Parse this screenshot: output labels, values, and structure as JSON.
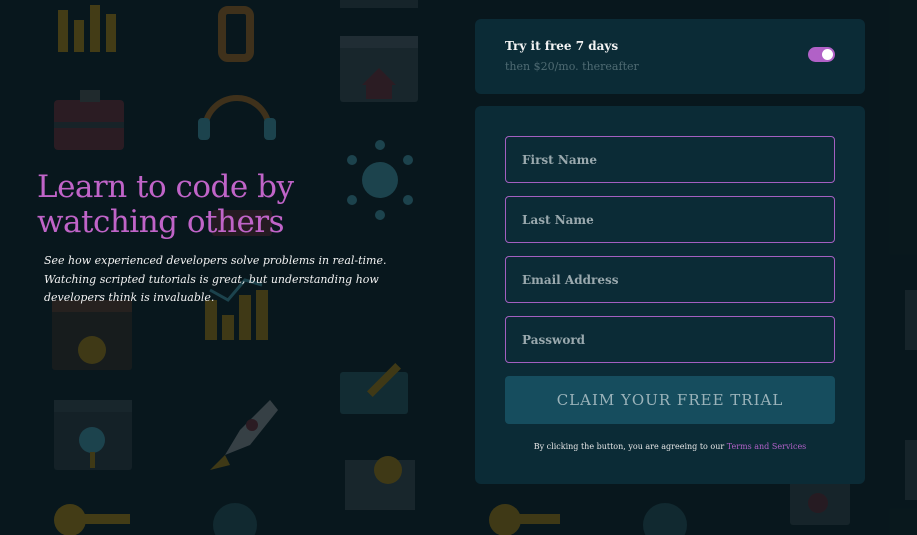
{
  "hero": {
    "title_line1": "Learn to code by",
    "title_line2": "watching others",
    "description": "See how experienced developers solve problems in real-time. Watching scripted tutorials is great, but understanding how developers think is invaluable."
  },
  "trial": {
    "title": "Try it free 7 days",
    "subtitle": "then $20/mo. thereafter",
    "toggle_on": true
  },
  "form": {
    "first_name_placeholder": "First Name",
    "last_name_placeholder": "Last Name",
    "email_placeholder": "Email Address",
    "password_placeholder": "Password",
    "submit_label": "CLAIM YOUR FREE TRIAL",
    "terms_prefix": "By clicking the button, you are agreeing to our",
    "terms_link": "Terms and Services"
  },
  "colors": {
    "accent": "#c064c8",
    "card_bg": "#0b2b36",
    "page_bg": "#0a1a1f",
    "button_bg": "#164d5e"
  }
}
